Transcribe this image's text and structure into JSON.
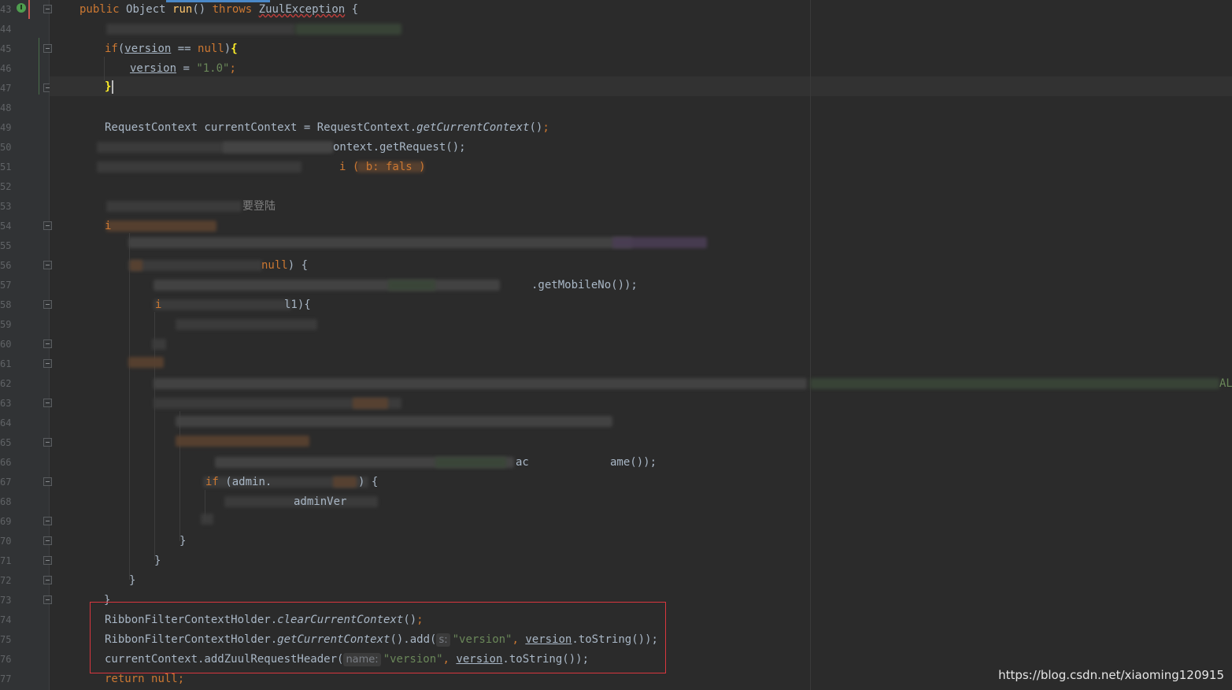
{
  "gutter": {
    "line_numbers": [
      "43",
      "44",
      "45",
      "46",
      "47",
      "48",
      "49",
      "50",
      "51",
      "52",
      "53",
      "54",
      "55",
      "56",
      "57",
      "58",
      "59",
      "60",
      "61",
      "62",
      "63",
      "64",
      "65",
      "66",
      "67",
      "68",
      "69",
      "70",
      "71",
      "72",
      "73",
      "74",
      "75",
      "76",
      "77"
    ]
  },
  "code": {
    "l43": {
      "public": "public",
      "type": "Object",
      "method": "run",
      "parens": "()",
      "throws": "throws",
      "exception": "ZuulException",
      "brace": "{"
    },
    "l45": {
      "if": "if",
      "open": "(",
      "var": "version",
      "op": " == ",
      "null": "null",
      "close": ")",
      "brace": "{"
    },
    "l46": {
      "var": "version",
      "assign": " = ",
      "value": "\"1.0\"",
      "semi": ";"
    },
    "l47": {
      "brace": "}"
    },
    "l49": {
      "type": "RequestContext currentContext = RequestContext.",
      "method": "getCurrentContext",
      "call": "()",
      "semi": ";"
    },
    "l50": {
      "tail": "ontext.getRequest();"
    },
    "l51": {
      "tail": "i ( b: fals )"
    },
    "l53": {
      "comment": "要登陆"
    },
    "l54": {
      "head": "i"
    },
    "l56": {
      "null": "null",
      "tail": ") {"
    },
    "l57": {
      "tail": ".getMobileNo());"
    },
    "l58": {
      "head": "i",
      "tail": "l1){"
    },
    "l62": {
      "tail": "AL"
    },
    "l66": {
      "mid": "ac",
      "tail": "ame());"
    },
    "l67": {
      "if": "if",
      "mid": "(admin.",
      "tail": ") {"
    },
    "l68": {
      "tail": "adminVer"
    },
    "l70": {
      "brace": "}"
    },
    "l71": {
      "brace": "}"
    },
    "l72": {
      "brace": "}"
    },
    "l73": {
      "brace": "}"
    },
    "l74": {
      "cls": "RibbonFilterContextHolder.",
      "method": "clearCurrentContext",
      "call": "()",
      "semi": ";"
    },
    "l75": {
      "cls": "RibbonFilterContextHolder.",
      "method": "getCurrentContext",
      "call": "().add(",
      "hint": "s:",
      "str": "\"version\"",
      "comma": ", ",
      "var": "version",
      "tail": ".toString());"
    },
    "l76": {
      "cls": "currentContext.addZuulRequestHeader(",
      "hint": "name:",
      "str": "\"version\"",
      "comma": ", ",
      "var": "version",
      "tail": ".toString());"
    },
    "l77": {
      "return": "return",
      "null": "null",
      "semi": ";"
    }
  },
  "watermark": "https://blog.csdn.net/xiaoming120915",
  "colors": {
    "background": "#2b2b2b",
    "keyword": "#cc7832",
    "string": "#6a8759",
    "method": "#ffc66d",
    "highlight_box": "#d9363e"
  }
}
